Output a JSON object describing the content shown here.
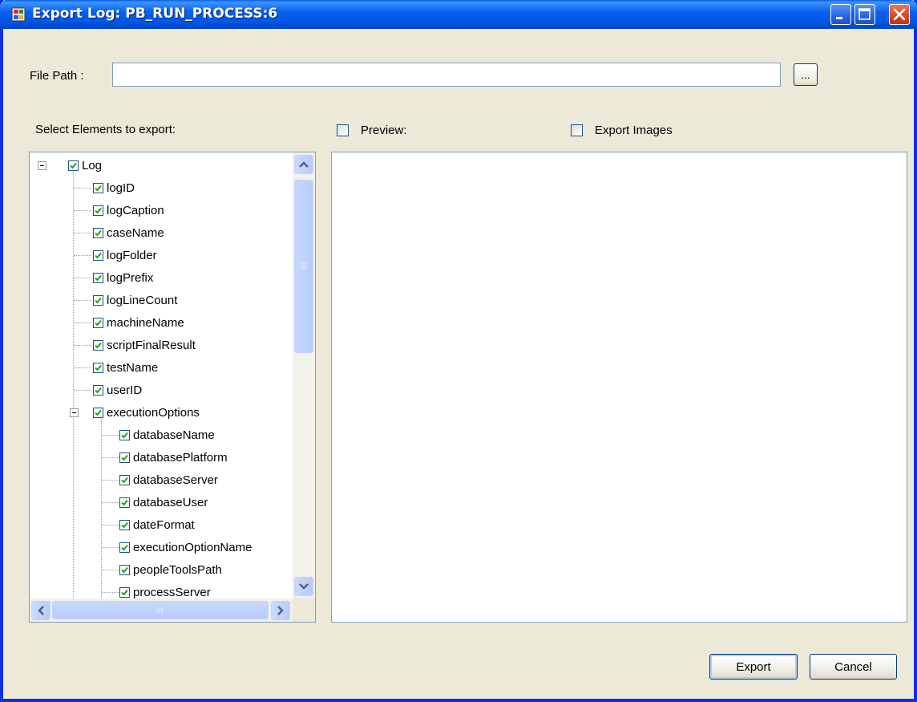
{
  "window": {
    "title": "Export Log: PB_RUN_PROCESS:6"
  },
  "file_path": {
    "label": "File Path :",
    "value": "",
    "browse_label": "..."
  },
  "select_label": "Select Elements to export:",
  "options": {
    "preview_label": "Preview:",
    "preview_checked": false,
    "export_images_label": "Export Images",
    "export_images_checked": false
  },
  "tree": {
    "root": {
      "label": "Log",
      "checked": true,
      "expanded": true
    },
    "children": [
      {
        "label": "logID",
        "checked": true
      },
      {
        "label": "logCaption",
        "checked": true
      },
      {
        "label": "caseName",
        "checked": true
      },
      {
        "label": "logFolder",
        "checked": true
      },
      {
        "label": "logPrefix",
        "checked": true
      },
      {
        "label": "logLineCount",
        "checked": true
      },
      {
        "label": "machineName",
        "checked": true
      },
      {
        "label": "scriptFinalResult",
        "checked": true
      },
      {
        "label": "testName",
        "checked": true
      },
      {
        "label": "userID",
        "checked": true
      },
      {
        "label": "executionOptions",
        "checked": true,
        "expanded": true
      }
    ],
    "execution_options_children": [
      {
        "label": "databaseName",
        "checked": true
      },
      {
        "label": "databasePlatform",
        "checked": true
      },
      {
        "label": "databaseServer",
        "checked": true
      },
      {
        "label": "databaseUser",
        "checked": true
      },
      {
        "label": "dateFormat",
        "checked": true
      },
      {
        "label": "executionOptionName",
        "checked": true
      },
      {
        "label": "peopleToolsPath",
        "checked": true
      },
      {
        "label": "processServer",
        "checked": true
      }
    ]
  },
  "buttons": {
    "export_label": "Export",
    "cancel_label": "Cancel"
  },
  "colors": {
    "titlebar": "#0054e3",
    "dialog_background": "#ece9d8",
    "check_green": "#21a121",
    "scrollbar_blue": "#b8ccfb"
  }
}
